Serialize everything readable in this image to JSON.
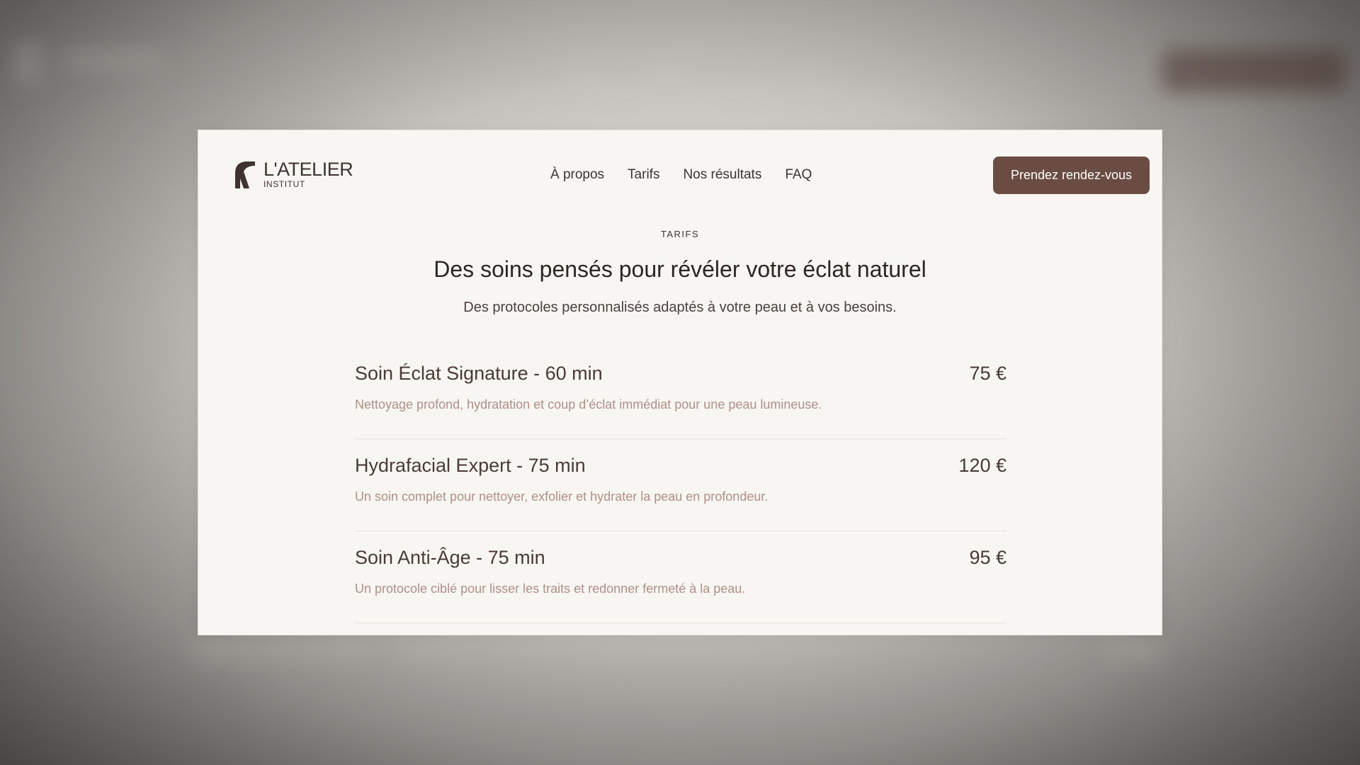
{
  "brand": {
    "name": "L'ATELIER",
    "tagline": "INSTITUT"
  },
  "nav": {
    "items": [
      {
        "label": "À propos"
      },
      {
        "label": "Tarifs"
      },
      {
        "label": "Nos résultats"
      },
      {
        "label": "FAQ"
      }
    ],
    "cta_label": "Prendez rendez-vous"
  },
  "section": {
    "eyebrow": "TARIFS",
    "title": "Des soins pensés pour révéler votre éclat naturel",
    "subtitle": "Des protocoles personnalisés adaptés à votre peau et à vos besoins."
  },
  "pricing": {
    "items": [
      {
        "title": "Soin Éclat Signature - 60 min",
        "price": "75 €",
        "description": "Nettoyage profond, hydratation et coup d’éclat immédiat pour une peau lumineuse."
      },
      {
        "title": "Hydrafacial Expert - 75 min",
        "price": "120 €",
        "description": "Un soin complet pour nettoyer, exfolier et hydrater la peau en profondeur."
      },
      {
        "title": "Soin Anti-Âge - 75 min",
        "price": "95 €",
        "description": "Un protocole ciblé pour lisser les traits et redonner fermeté à la peau."
      }
    ]
  },
  "colors": {
    "accent": "#6a4c43",
    "card_bg": "#f8f6f2",
    "text_dark": "#2d2523",
    "text_muted": "#b08f86"
  }
}
